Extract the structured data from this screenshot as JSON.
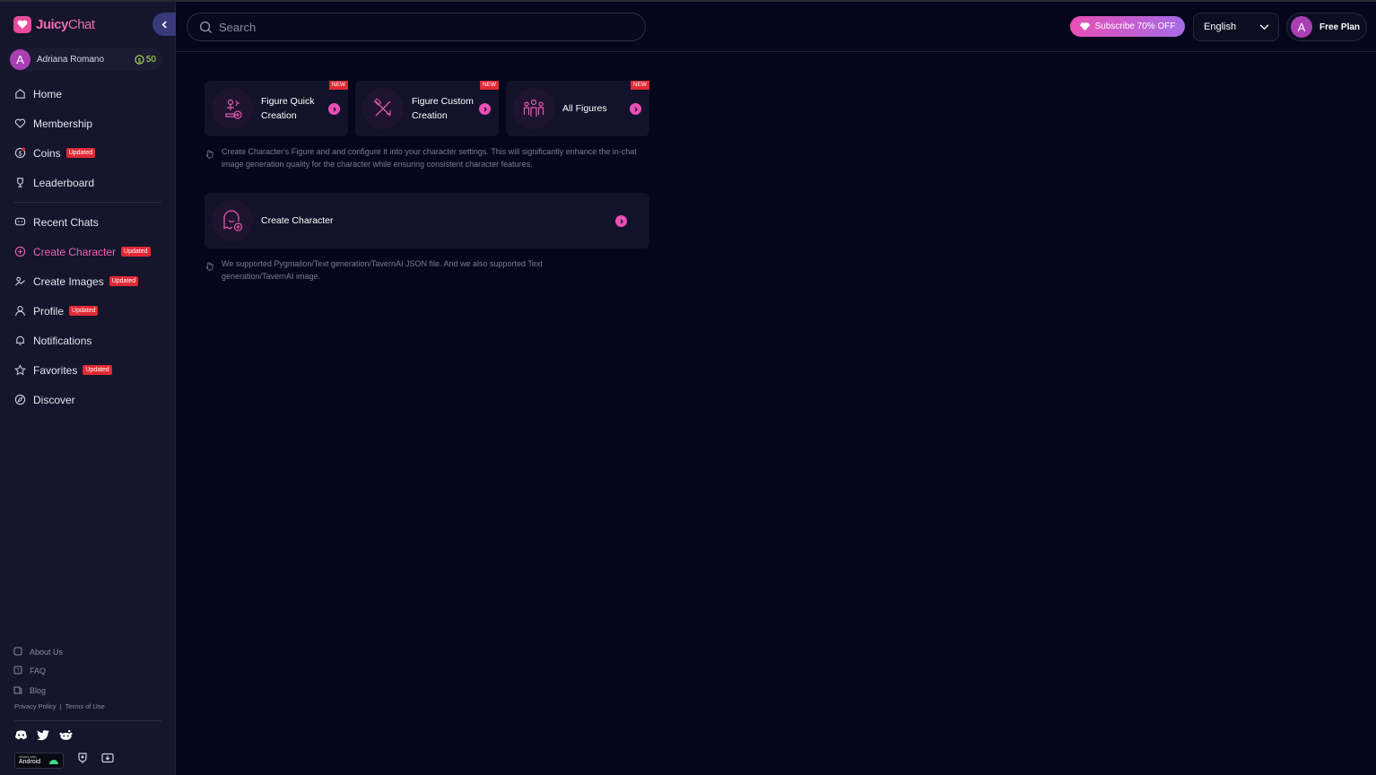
{
  "brand": {
    "juicy": "Juicy",
    "chat": "Chat"
  },
  "user": {
    "initial": "A",
    "name": "Adriana Romano",
    "coins": "50"
  },
  "sidebar": {
    "items": [
      {
        "label": "Home",
        "icon": "home-icon"
      },
      {
        "label": "Membership",
        "icon": "heart-icon"
      },
      {
        "label": "Coins",
        "icon": "coins-icon",
        "badge": "Updated"
      },
      {
        "label": "Leaderboard",
        "icon": "trophy-icon"
      },
      {
        "label": "Recent Chats",
        "icon": "chat-icon"
      },
      {
        "label": "Create Character",
        "icon": "create-character-icon",
        "badge": "Updated"
      },
      {
        "label": "Create Images",
        "icon": "image-icon",
        "badge": "Updated"
      },
      {
        "label": "Profile",
        "icon": "user-icon",
        "badge": "Updated"
      },
      {
        "label": "Notifications",
        "icon": "bell-icon"
      },
      {
        "label": "Favorites",
        "icon": "star-icon",
        "badge": "Updated"
      },
      {
        "label": "Discover",
        "icon": "compass-icon"
      }
    ],
    "footer": {
      "about": "About Us",
      "faq": "FAQ",
      "blog": "Blog",
      "privacy": "Privacy Policy",
      "separator": "|",
      "terms": "Terms of Use"
    },
    "android": {
      "small": "Works with",
      "big": "Android"
    }
  },
  "header": {
    "search_placeholder": "Search",
    "subscribe": "Subscribe 70% OFF",
    "language": "English",
    "plan": "Free Plan",
    "plan_initial": "A"
  },
  "main": {
    "cards": [
      {
        "title": "Figure Quick Creation",
        "tag": "NEW"
      },
      {
        "title": "Figure Custom Creation",
        "tag": "NEW"
      },
      {
        "title": "All Figures",
        "tag": "NEW"
      }
    ],
    "figure_hint": "Create Character's Figure and and configure it into your character settings. This will significantly enhance the in-chat image generation quality for the character while ensuring consistent character features.",
    "create_character": "Create Character",
    "import_hint": "We supported Pygmalion/Text generation/TavernAI JSON file. And we also supported Text generation/TavernAI image."
  },
  "colors": {
    "accent": "#e94fb5",
    "badge": "#e02a35",
    "background": "#05051c",
    "sidebar": "#15152b"
  }
}
